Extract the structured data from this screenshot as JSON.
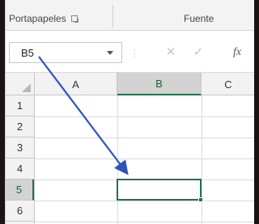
{
  "ribbon": {
    "clipboard_label": "Portapapeles",
    "font_label": "Fuente"
  },
  "formula_bar": {
    "name_box_value": "B5",
    "cancel_icon": "✕",
    "enter_icon": "✓",
    "fx_label": "fx"
  },
  "grid": {
    "columns": [
      "A",
      "B",
      "C"
    ],
    "rows": [
      "1",
      "2",
      "3",
      "4",
      "5",
      "6"
    ],
    "selected_cell": "B5"
  },
  "annotation": {
    "arrow_color": "#2f53b8"
  },
  "colors": {
    "excel_green": "#217346",
    "header_bg": "#f2f2f2",
    "selected_header_bg": "#d3d3d3"
  }
}
